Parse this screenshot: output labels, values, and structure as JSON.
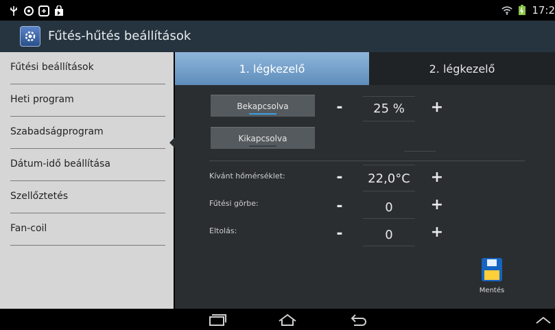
{
  "status_bar": {
    "clock": "17:2",
    "icons": [
      "usb-icon",
      "sync-icon",
      "screenshot-icon",
      "shopping-bag-icon",
      "wifi-icon",
      "battery-icon"
    ]
  },
  "app": {
    "title": "Fűtés-hűtés beállítások",
    "icon": "settings-app-icon"
  },
  "sidebar": {
    "items": [
      {
        "label": "Fűtési beállítások"
      },
      {
        "label": "Heti program"
      },
      {
        "label": "Szabadságprogram"
      },
      {
        "label": "Dátum-idő beállítása"
      },
      {
        "label": "Szellőztetés"
      },
      {
        "label": "Fan-coil"
      }
    ],
    "selected": "Szellőztetés"
  },
  "tabs": [
    {
      "label": "1. légkezelő",
      "active": true
    },
    {
      "label": "2. légkezelő",
      "active": false
    }
  ],
  "controls": {
    "on_button": "Bekapcsolva",
    "off_button": "Kikapcsolva",
    "power_percent": "25 %",
    "desired_temp_label": "Kívánt hőmérséklet:",
    "desired_temp_value": "22,0°C",
    "heating_curve_label": "Fűtési görbe:",
    "heating_curve_value": "0",
    "offset_label": "Eltolás:",
    "offset_value": "0",
    "minus": "-",
    "plus": "+"
  },
  "save": {
    "label": "Mentés"
  },
  "colors": {
    "accent_tab": "#6f9fcf",
    "sidebar_bg": "#d6d6d6",
    "main_bg": "#2a2e31",
    "indicator_on": "#3aa0e6"
  }
}
